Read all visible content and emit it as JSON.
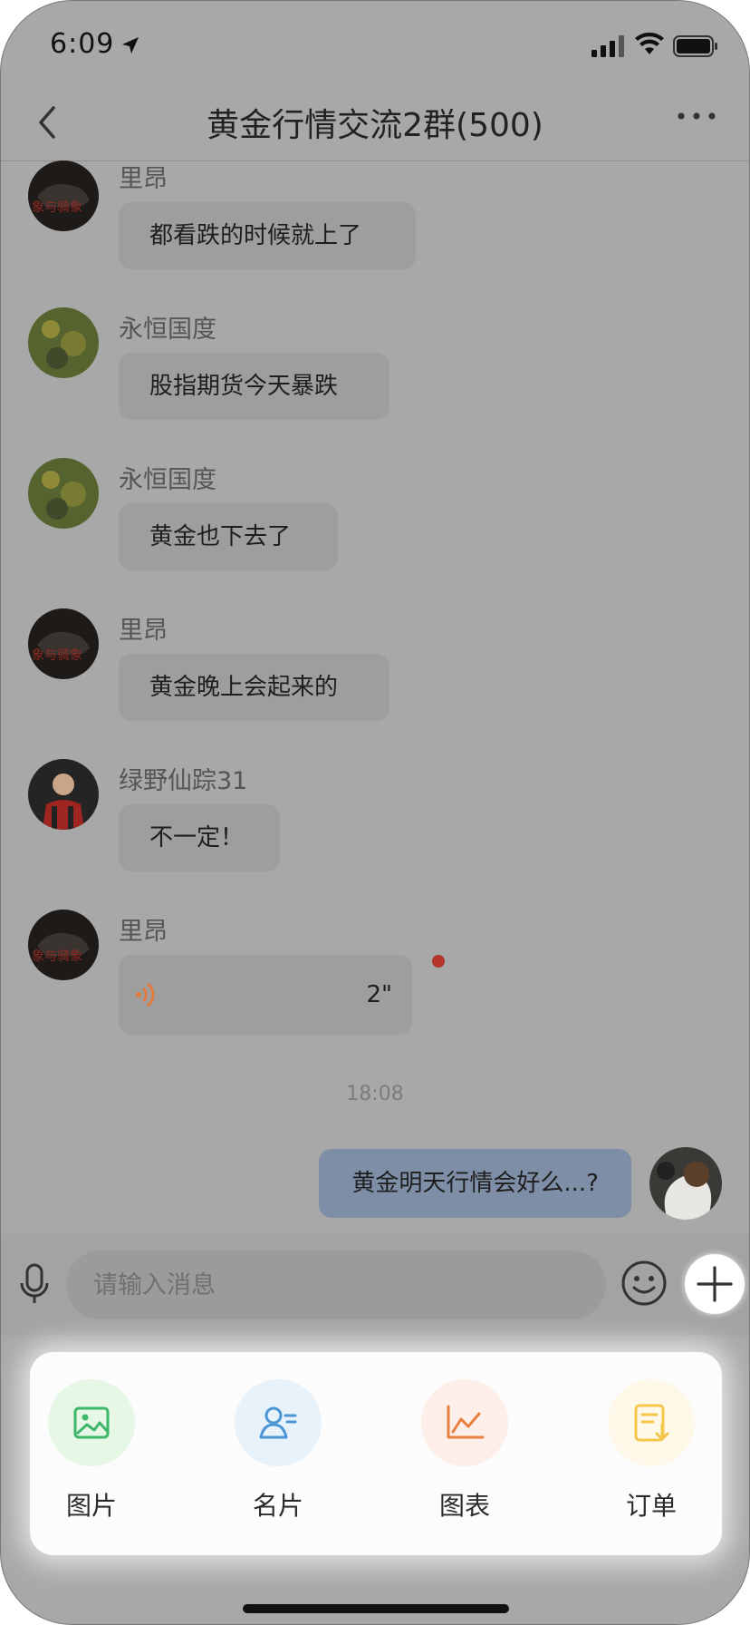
{
  "status_bar": {
    "time": "6:09"
  },
  "header": {
    "title": "黄金行情交流2群(500)"
  },
  "messages": [
    {
      "nick": "里昂",
      "text": "都看跌的时候就上了"
    },
    {
      "nick": "永恒国度",
      "text": "股指期货今天暴跌"
    },
    {
      "nick": "永恒国度",
      "text": "黄金也下去了"
    },
    {
      "nick": "里昂",
      "text": "黄金晚上会起来的"
    },
    {
      "nick": "绿野仙踪31",
      "text": "不一定！"
    },
    {
      "nick": "里昂",
      "voice_duration": "2\""
    }
  ],
  "timestamp": "18:08",
  "my_message": {
    "text": "黄金明天行情会好么...?"
  },
  "input": {
    "placeholder": "请输入消息"
  },
  "panel": {
    "items": [
      {
        "label": "图片",
        "icon": "image-icon",
        "bg": "#e6f7e6",
        "color": "#3fb76a"
      },
      {
        "label": "名片",
        "icon": "contact-card-icon",
        "bg": "#e7f2fb",
        "color": "#4b95d6"
      },
      {
        "label": "图表",
        "icon": "chart-icon",
        "bg": "#fdeee9",
        "color": "#e9803f"
      },
      {
        "label": "订单",
        "icon": "order-icon",
        "bg": "#fdf8e7",
        "color": "#f2c74b"
      }
    ]
  },
  "colors": {
    "overlay_background": "#a8a8a8",
    "bubble_other": "#9e9e9e",
    "bubble_me": "#7e8ea6",
    "unread_dot": "#b4342a",
    "voice_wave": "#e07a3f"
  }
}
